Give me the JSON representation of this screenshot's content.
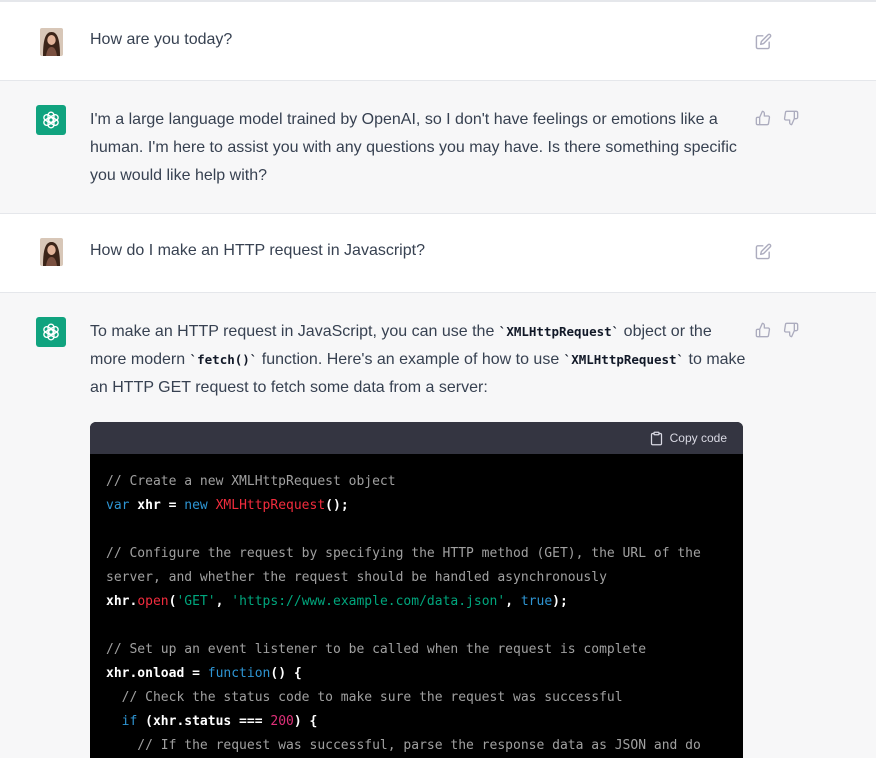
{
  "conversation": {
    "turn1": {
      "role": "user",
      "text": "How are you today?"
    },
    "turn2": {
      "role": "assistant",
      "text": "I'm a large language model trained by OpenAI, so I don't have feelings or emotions like a human. I'm here to assist you with any questions you may have. Is there something specific you would like help with?"
    },
    "turn3": {
      "role": "user",
      "text": "How do I make an HTTP request in Javascript?"
    },
    "turn4": {
      "role": "assistant",
      "intro_part1": "To make an HTTP request in JavaScript, you can use the ",
      "intro_code1": "`XMLHttpRequest`",
      "intro_part2": " object or the more modern ",
      "intro_code2": "`fetch()`",
      "intro_part3": " function. Here's an example of how to use ",
      "intro_code3": "`XMLHttpRequest`",
      "intro_part4": " to make an HTTP GET request to fetch some data from a server:",
      "code": {
        "copy_label": "Copy code",
        "lines": {
          "l1_comment": "// Create a new XMLHttpRequest object",
          "l2_var": "var",
          "l2_name": " xhr = ",
          "l2_new": "new",
          "l2_cls": "XMLHttpRequest",
          "l2_end": "();",
          "l4_comment": "// Configure the request by specifying the HTTP method (GET), the URL of the",
          "l5_comment": "server, and whether the request should be handled asynchronously",
          "l6_obj": "xhr.",
          "l6_fn": "open",
          "l6_p1": "(",
          "l6_s1": "'GET'",
          "l6_p2": ", ",
          "l6_s2": "'https://www.example.com/data.json'",
          "l6_p3": ", ",
          "l6_true": "true",
          "l6_end": ");",
          "l8_comment": "// Set up an event listener to be called when the request is complete",
          "l9_obj": "xhr.onload = ",
          "l9_fn": "function",
          "l9_end": "() {",
          "l10_comment": "  // Check the status code to make sure the request was successful",
          "l11_if": "  if",
          "l11_mid": " (xhr.status === ",
          "l11_num": "200",
          "l11_end": ") {",
          "l12_comment": "    // If the request was successful, parse the response data as JSON and do"
        }
      }
    }
  },
  "colors": {
    "assistant_bg": "#f7f7f8",
    "user_bg": "#ffffff",
    "bot_avatar": "#10a37f",
    "code_bg": "#000000",
    "code_header_bg": "#343541"
  },
  "icons": [
    "edit-icon",
    "thumbs-up-icon",
    "thumbs-down-icon",
    "openai-logo-icon",
    "clipboard-icon"
  ]
}
